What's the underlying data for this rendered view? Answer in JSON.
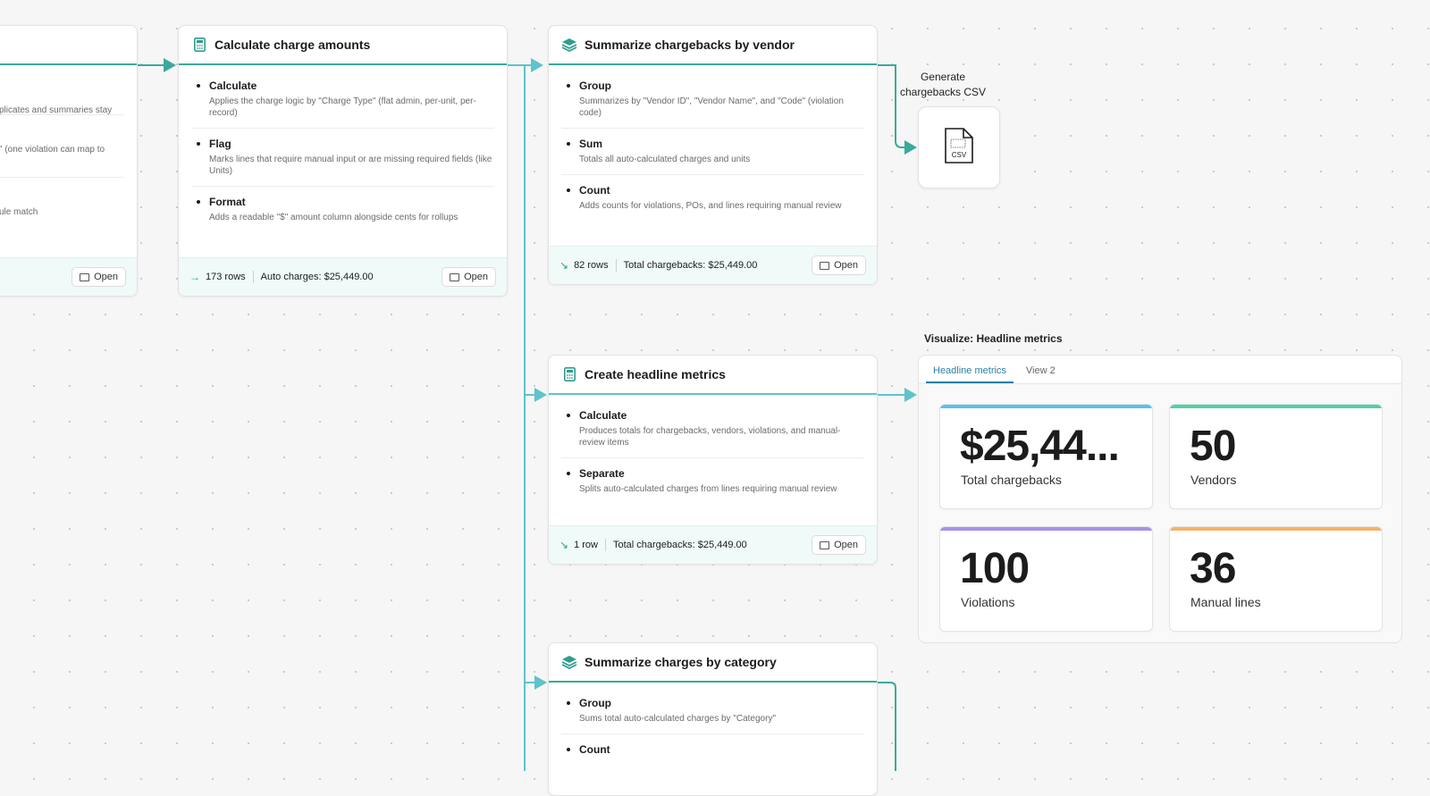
{
  "colors": {
    "accent": "#3aa99a",
    "wire_light": "#5ec3cc",
    "metric_blue": "#5bc0eb",
    "metric_green": "#4fd1a5",
    "metric_purple": "#a592e8",
    "metric_orange": "#f6b26b"
  },
  "left_card": {
    "steps": [
      {
        "desc": "plicates and summaries stay"
      },
      {
        "desc": "\" (one violation can map to"
      },
      {
        "desc": "ule match"
      }
    ],
    "open_label": "Open"
  },
  "calc_card": {
    "title": "Calculate charge amounts",
    "icon": "calculator-icon",
    "steps": [
      {
        "title": "Calculate",
        "desc": "Applies the charge logic by \"Charge Type\" (flat admin, per-unit, per-record)"
      },
      {
        "title": "Flag",
        "desc": "Marks lines that require manual input or are missing required fields (like Units)"
      },
      {
        "title": "Format",
        "desc": "Adds a readable \"$\" amount column alongside cents for rollups"
      }
    ],
    "footer": {
      "rows": "173 rows",
      "summary": "Auto charges: $25,449.00",
      "open_label": "Open"
    }
  },
  "vendor_card": {
    "title": "Summarize chargebacks by vendor",
    "icon": "layers-icon",
    "steps": [
      {
        "title": "Group",
        "desc": "Summarizes by \"Vendor ID\", \"Vendor Name\", and \"Code\" (violation code)"
      },
      {
        "title": "Sum",
        "desc": "Totals all auto-calculated charges and units"
      },
      {
        "title": "Count",
        "desc": "Adds counts for violations, POs, and lines requiring manual review"
      }
    ],
    "footer": {
      "rows": "82 rows",
      "summary": "Total chargebacks: $25,449.00",
      "open_label": "Open"
    }
  },
  "csv_output": {
    "label": "Generate chargebacks CSV",
    "icon": "csv-file-icon",
    "badge": "CSV"
  },
  "headline_card": {
    "title": "Create headline metrics",
    "icon": "calculator-icon",
    "steps": [
      {
        "title": "Calculate",
        "desc": "Produces totals for chargebacks, vendors, violations, and manual-review items"
      },
      {
        "title": "Separate",
        "desc": "Splits auto-calculated charges from lines requiring manual review"
      }
    ],
    "footer": {
      "rows": "1 row",
      "summary": "Total chargebacks: $25,449.00",
      "open_label": "Open"
    }
  },
  "category_card": {
    "title": "Summarize charges by category",
    "icon": "layers-icon",
    "steps": [
      {
        "title": "Group",
        "desc": "Sums total auto-calculated charges by \"Category\""
      },
      {
        "title": "Count",
        "desc": ""
      }
    ]
  },
  "visualize": {
    "label": "Visualize: Headline metrics",
    "tabs": [
      {
        "label": "Headline metrics",
        "active": true
      },
      {
        "label": "View 2",
        "active": false
      }
    ],
    "metrics": [
      {
        "value": "$25,44...",
        "label": "Total chargebacks"
      },
      {
        "value": "50",
        "label": "Vendors"
      },
      {
        "value": "100",
        "label": "Violations"
      },
      {
        "value": "36",
        "label": "Manual lines"
      }
    ]
  }
}
